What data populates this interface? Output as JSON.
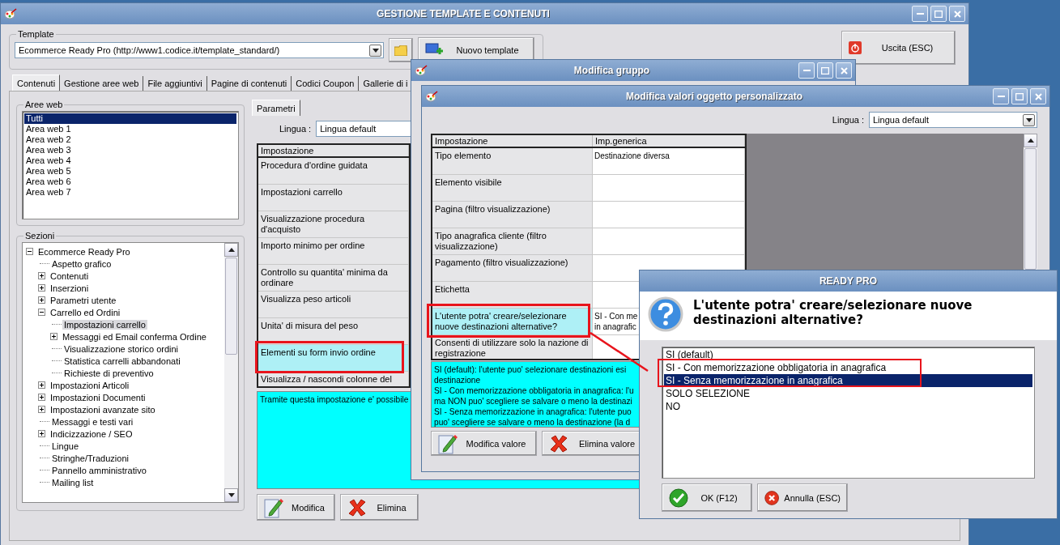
{
  "main_window": {
    "title": "GESTIONE TEMPLATE E CONTENUTI",
    "template": {
      "label": "Template",
      "value": "Ecommerce Ready Pro (http://www1.codice.it/template_standard/)",
      "new_button": "Nuovo template"
    },
    "exit_button": "Uscita (ESC)",
    "tabs": [
      {
        "label": "Contenuti",
        "selected": true
      },
      {
        "label": "Gestione aree web",
        "selected": false
      },
      {
        "label": "File aggiuntivi",
        "selected": false
      },
      {
        "label": "Pagine di contenuti",
        "selected": false
      },
      {
        "label": "Codici Coupon",
        "selected": false
      },
      {
        "label": "Gallerie di i",
        "selected": false
      }
    ],
    "web_areas": {
      "label": "Aree web",
      "items": [
        {
          "label": "Tutti",
          "selected": true
        },
        {
          "label": "Area web 1",
          "selected": false
        },
        {
          "label": "Area web 2",
          "selected": false
        },
        {
          "label": "Area web 3",
          "selected": false
        },
        {
          "label": "Area web 4",
          "selected": false
        },
        {
          "label": "Area web 5",
          "selected": false
        },
        {
          "label": "Area web 6",
          "selected": false
        },
        {
          "label": "Area web 7",
          "selected": false
        }
      ]
    },
    "sections": {
      "label": "Sezioni",
      "tree": [
        {
          "label": "Ecommerce Ready Pro",
          "selected": false,
          "expanded": true,
          "children": [
            {
              "label": "Aspetto grafico",
              "selected": false
            },
            {
              "label": "Contenuti",
              "selected": false,
              "expanded": false
            },
            {
              "label": "Inserzioni",
              "selected": false,
              "expanded": false
            },
            {
              "label": "Parametri utente",
              "selected": false,
              "expanded": false
            },
            {
              "label": "Carrello ed Ordini",
              "selected": false,
              "expanded": true,
              "children": [
                {
                  "label": "Impostazioni carrello",
                  "selected": true
                },
                {
                  "label": "Messaggi ed Email conferma Ordine",
                  "selected": false,
                  "expanded": false
                },
                {
                  "label": "Visualizzazione storico ordini",
                  "selected": false
                },
                {
                  "label": "Statistica carrelli abbandonati",
                  "selected": false
                },
                {
                  "label": "Richieste di preventivo",
                  "selected": false
                }
              ]
            },
            {
              "label": "Impostazioni Articoli",
              "selected": false,
              "expanded": false
            },
            {
              "label": "Impostazioni Documenti",
              "selected": false,
              "expanded": false
            },
            {
              "label": "Impostazioni avanzate sito",
              "selected": false,
              "expanded": false
            },
            {
              "label": "Messaggi e testi vari",
              "selected": false
            },
            {
              "label": "Indicizzazione / SEO",
              "selected": false,
              "expanded": false
            },
            {
              "label": "Lingue",
              "selected": false
            },
            {
              "label": "Stringhe/Traduzioni",
              "selected": false
            },
            {
              "label": "Pannello amministrativo",
              "selected": false
            },
            {
              "label": "Mailing list",
              "selected": false
            }
          ]
        }
      ]
    },
    "param_tabs": [
      {
        "label": "Parametri",
        "selected": true
      }
    ],
    "language": {
      "label": "Lingua :",
      "value": "Lingua default"
    },
    "table": {
      "columns": [
        "Impostazione"
      ],
      "rows": [
        {
          "label": "Procedura d'ordine guidata",
          "highlighted": false
        },
        {
          "label": "Impostazioni carrello",
          "highlighted": false
        },
        {
          "label": "Visualizzazione procedura d'acquisto",
          "highlighted": false
        },
        {
          "label": "Importo minimo per ordine",
          "highlighted": false
        },
        {
          "label": "Controllo su quantita' minima da ordinare",
          "highlighted": false
        },
        {
          "label": "Visualizza peso articoli",
          "highlighted": false
        },
        {
          "label": "Unita' di misura del peso",
          "highlighted": false
        },
        {
          "label": "Elementi su form invio ordine",
          "highlighted": true
        },
        {
          "label": "Visualizza / nascondi colonne del",
          "highlighted": false
        }
      ]
    },
    "description": "Tramite questa impostazione e' possibile",
    "buttons": [
      {
        "kind": "edit",
        "label": "Modifica"
      },
      {
        "kind": "delete",
        "label": "Elimina"
      }
    ]
  },
  "group_window": {
    "title": "Modifica gruppo"
  },
  "values_window": {
    "title": "Modifica valori oggetto personalizzato",
    "language": {
      "label": "Lingua :",
      "value": "Lingua default"
    },
    "table": {
      "columns": [
        "Impostazione",
        "Imp.generica"
      ],
      "rows": [
        {
          "label": "Tipo elemento",
          "value": "Destinazione diversa",
          "highlighted": false
        },
        {
          "label": "Elemento visibile",
          "highlighted": false
        },
        {
          "label": "Pagina (filtro visualizzazione)",
          "highlighted": false
        },
        {
          "label": "Tipo anagrafica cliente (filtro visualizzazione)",
          "highlighted": false
        },
        {
          "label": "Pagamento (filtro visualizzazione)",
          "highlighted": false
        },
        {
          "label": "Etichetta",
          "highlighted": false
        },
        {
          "label": "L'utente potra' creare/selezionare nuove destinazioni alternative?",
          "value_lines": [
            "SI - Con me",
            "in anagrafic"
          ],
          "highlighted": true
        },
        {
          "label": "Consenti di utilizzare solo la nazione di registrazione",
          "highlighted": false
        }
      ]
    },
    "description_lines": [
      "SI (default): l'utente puo' selezionare destinazioni esi",
      "destinazione",
      "SI - Con memorizzazione obbligatoria in anagrafica: l'u",
      "ma NON puo' scegliere se salvare o meno la destinazi",
      "SI - Senza memorizzazione in anagrafica: l'utente puo",
      "puo' scegliere se salvare o meno la destinazione (la d"
    ],
    "buttons": [
      {
        "kind": "edit",
        "label": "Modifica valore"
      },
      {
        "kind": "delete",
        "label": "Elimina valore"
      }
    ]
  },
  "dialog": {
    "title": "READY PRO",
    "question": "L'utente potra' creare/selezionare nuove destinazioni alternative?",
    "options": [
      {
        "label": "SI (default)",
        "selected": false
      },
      {
        "label": "SI - Con memorizzazione obbligatoria in anagrafica",
        "selected": false
      },
      {
        "label": "SI - Senza memorizzazione in anagrafica",
        "selected": true
      },
      {
        "label": "SOLO SELEZIONE",
        "selected": false
      },
      {
        "label": "NO",
        "selected": false
      }
    ],
    "buttons": [
      {
        "kind": "ok",
        "label": "OK (F12)"
      },
      {
        "kind": "cancel",
        "label": "Annulla (ESC)"
      }
    ]
  }
}
